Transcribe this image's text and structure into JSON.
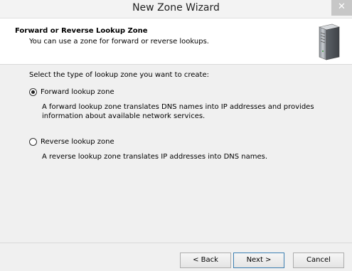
{
  "window": {
    "title": "New Zone Wizard",
    "close_glyph": "✕"
  },
  "header": {
    "title": "Forward or Reverse Lookup Zone",
    "subtitle": "You can use a zone for forward or reverse lookups.",
    "icon": "server-icon"
  },
  "body": {
    "prompt": "Select the type of lookup zone you want to create:",
    "options": [
      {
        "label": "Forward lookup zone",
        "description": "A forward lookup zone translates DNS names into IP addresses and provides information about available network services.",
        "selected": true
      },
      {
        "label": "Reverse lookup zone",
        "description": "A reverse lookup zone translates IP addresses into DNS names.",
        "selected": false
      }
    ]
  },
  "footer": {
    "back_label": "< Back",
    "next_label": "Next >",
    "cancel_label": "Cancel"
  },
  "colors": {
    "accent": "#3c7fb1",
    "background": "#f0f0f0",
    "header_background": "#ffffff"
  }
}
